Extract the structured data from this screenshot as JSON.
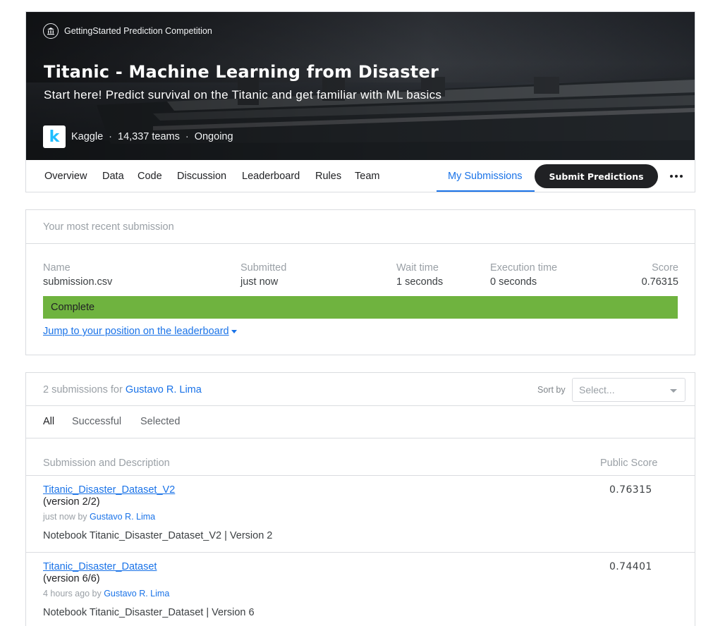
{
  "header": {
    "competition_type": "GettingStarted Prediction Competition",
    "title": "Titanic - Machine Learning from Disaster",
    "subtitle": "Start here! Predict survival on the Titanic and get familiar with ML basics",
    "logo_letter": "k",
    "host": "Kaggle",
    "teams": "14,337 teams",
    "status": "Ongoing",
    "separator": "·"
  },
  "tabs": [
    "Overview",
    "Data",
    "Code",
    "Discussion",
    "Leaderboard",
    "Rules",
    "Team",
    "My Submissions"
  ],
  "active_tab": "My Submissions",
  "submit_button": "Submit Predictions",
  "recent": {
    "heading": "Your most recent submission",
    "columns": [
      {
        "label": "Name",
        "value": "submission.csv"
      },
      {
        "label": "Submitted",
        "value": "just now"
      },
      {
        "label": "Wait time",
        "value": "1 seconds"
      },
      {
        "label": "Execution time",
        "value": "0 seconds"
      },
      {
        "label": "Score",
        "value": "0.76315"
      }
    ],
    "status": "Complete",
    "status_color": "#6fb33f",
    "jump_link": "Jump to your position on the leaderboard"
  },
  "submissions": {
    "count_text": "2 submissions for",
    "user": "Gustavo R. Lima",
    "sort_label": "Sort by",
    "sort_placeholder": "Select...",
    "filters": [
      "All",
      "Successful",
      "Selected"
    ],
    "col_desc": "Submission and Description",
    "col_score": "Public Score",
    "rows": [
      {
        "name": "Titanic_Disaster_Dataset_V2",
        "version": "(version 2/2)",
        "when": "just now by",
        "by": "Gustavo R. Lima",
        "desc": "Notebook Titanic_Disaster_Dataset_V2 | Version 2",
        "score": "0.76315"
      },
      {
        "name": "Titanic_Disaster_Dataset",
        "version": "(version 6/6)",
        "when": "4 hours ago by",
        "by": "Gustavo R. Lima",
        "desc": "Notebook Titanic_Disaster_Dataset | Version 6",
        "score": "0.74401"
      }
    ]
  },
  "icons": {
    "competition": "bank-icon",
    "more": "more-horizontal-icon",
    "caret": "caret-down-icon"
  },
  "colors": {
    "accent": "#1a73e8",
    "complete": "#6fb33f",
    "button": "#202124",
    "kaggle": "#20beff"
  }
}
